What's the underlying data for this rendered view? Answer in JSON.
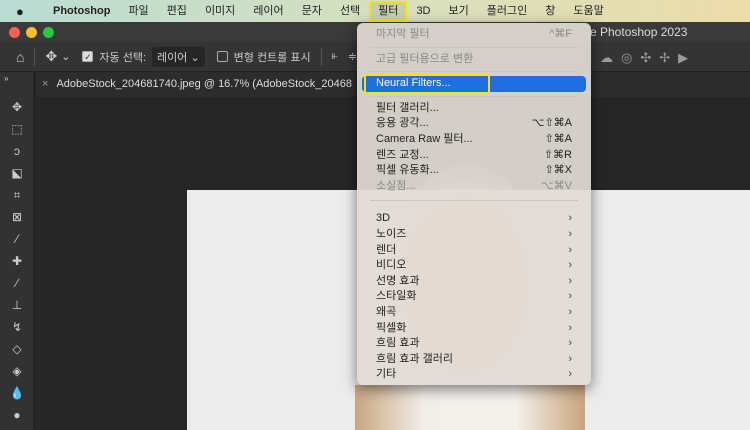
{
  "menubar": {
    "app": "Photoshop",
    "items": [
      "파일",
      "편집",
      "이미지",
      "레이어",
      "문자",
      "선택",
      "필터",
      "3D",
      "보기",
      "플러그인",
      "창",
      "도움말"
    ],
    "active": "필터"
  },
  "window": {
    "title": "e Photoshop 2023"
  },
  "options": {
    "auto_select_label": "자동 선택:",
    "auto_select_value": "레이어",
    "transform_controls_label": "변형 컨트롤 표시"
  },
  "document_tab": {
    "title": "AdobeStock_204681740.jpeg @ 16.7% (AdobeStock_20468"
  },
  "filter_menu": {
    "group1": [
      {
        "label": "마지막 필터",
        "shortcut": "^⌘F"
      }
    ],
    "group2": [
      {
        "label": "고급 필터용으로 변환"
      }
    ],
    "highlighted": {
      "label": "Neural Filters..."
    },
    "group3": [
      {
        "label": "필터 갤러리...",
        "shortcut": ""
      },
      {
        "label": "응용 광각...",
        "shortcut": "⌥⇧⌘A"
      },
      {
        "label": "Camera Raw 필터...",
        "shortcut": "⇧⌘A"
      },
      {
        "label": "렌즈 교정...",
        "shortcut": "⇧⌘R"
      },
      {
        "label": "픽셀 유동화...",
        "shortcut": "⇧⌘X"
      },
      {
        "label": "소실점...",
        "shortcut": "⌥⌘V"
      }
    ],
    "submenus": [
      "3D",
      "노이즈",
      "렌더",
      "비디오",
      "선명 효과",
      "스타일화",
      "왜곡",
      "픽셀화",
      "흐림 효과",
      "흐림 효과 갤러리",
      "기타"
    ]
  },
  "colors": {
    "highlight": "#1f6fe0",
    "annotation": "#f5e600"
  }
}
